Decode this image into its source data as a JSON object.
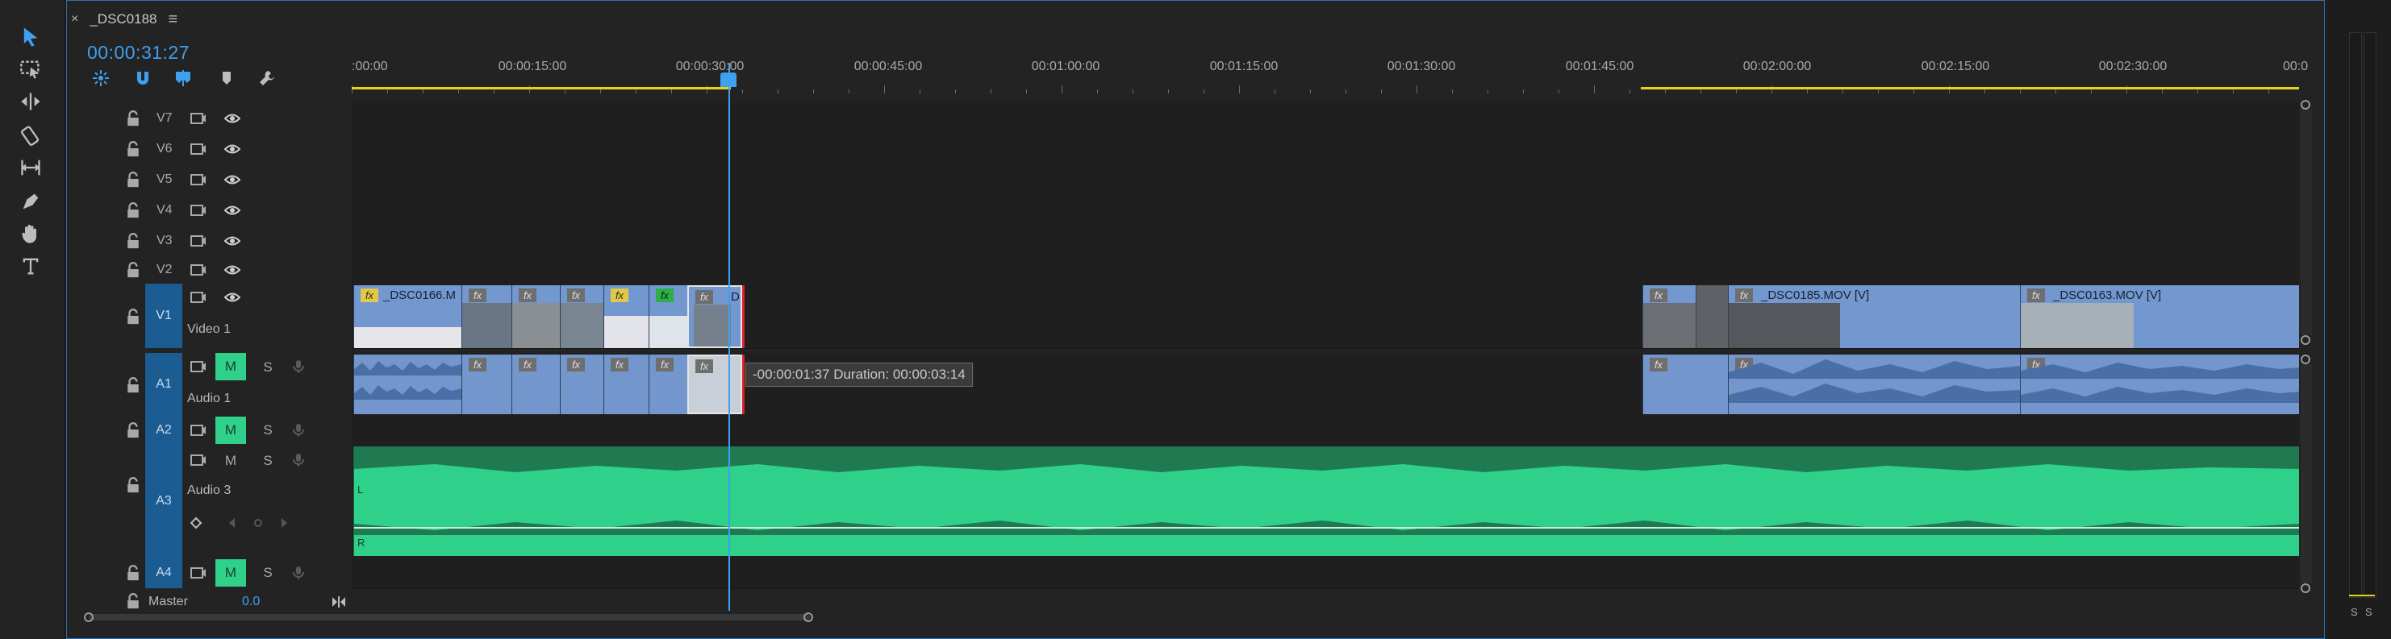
{
  "tab": {
    "close": "×",
    "title": "_DSC0188",
    "menu": "≡"
  },
  "timecode": "00:00:31:27",
  "tools": [
    "selection-tool",
    "track-select-tool",
    "ripple-edit-tool",
    "razor-tool",
    "slip-tool",
    "pen-tool",
    "hand-tool",
    "type-tool"
  ],
  "timeline_controls": [
    "snap-icon",
    "linked-selection-icon",
    "add-marker-icon",
    "marker-icon",
    "settings-wrench-icon"
  ],
  "ruler": {
    "labels": [
      ":00:00",
      "00:00:15:00",
      "00:00:30:00",
      "00:00:45:00",
      "00:01:00:00",
      "00:01:15:00",
      "00:01:30:00",
      "00:01:45:00",
      "00:02:00:00",
      "00:02:15:00",
      "00:02:30:00",
      "00:0"
    ]
  },
  "video_tracks": [
    {
      "id": "V7",
      "label": "V7"
    },
    {
      "id": "V6",
      "label": "V6"
    },
    {
      "id": "V5",
      "label": "V5"
    },
    {
      "id": "V4",
      "label": "V4"
    },
    {
      "id": "V3",
      "label": "V3"
    },
    {
      "id": "V2",
      "label": "V2"
    },
    {
      "id": "V1",
      "label": "V1",
      "name": "Video 1"
    }
  ],
  "audio_tracks": [
    {
      "id": "A1",
      "label": "A1",
      "name": "Audio 1",
      "mute": "M",
      "solo": "S"
    },
    {
      "id": "A2",
      "label": "A2",
      "mute": "M",
      "solo": "S"
    },
    {
      "id": "A3",
      "label": "A3",
      "name": "Audio 3",
      "mute": "M",
      "solo": "S"
    },
    {
      "id": "A4",
      "label": "A4",
      "mute": "M",
      "solo": "S"
    }
  ],
  "master": {
    "label": "Master",
    "value": "0.0"
  },
  "clips": {
    "v1_first": "_DSC0166.M",
    "v1_d": "D",
    "v1_dsc0185": "_DSC0185.MOV [V]",
    "v1_dsc0163": "_DSC0163.MOV [V]",
    "fx": "fx"
  },
  "tooltip": "-00:00:01:37 Duration: 00:00:03:14",
  "audio3_channels": {
    "left": "L",
    "right": "R"
  },
  "meter_labels": {
    "left": "S",
    "right": "S"
  },
  "colors": {
    "accent": "#3f9ff1",
    "video_clip": "#7397cf",
    "audio_clip": "#7396cc",
    "music_clip": "#2ed08a",
    "work_area": "#e4d21c",
    "selected_track": "#1b5c93"
  }
}
